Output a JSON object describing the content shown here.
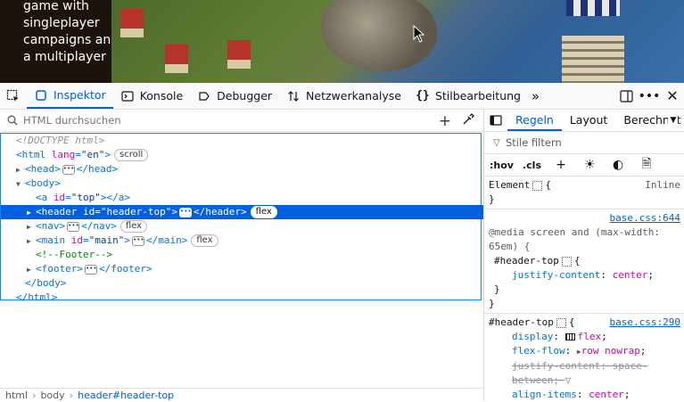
{
  "preview": {
    "intro_text": "game with singleplayer campaigns and a multiplayer"
  },
  "toolbar": {
    "tabs": [
      {
        "label": "Inspektor",
        "icon": "inspector-icon",
        "active": true
      },
      {
        "label": "Konsole",
        "icon": "console-icon"
      },
      {
        "label": "Debugger",
        "icon": "debugger-icon"
      },
      {
        "label": "Netzwerkanalyse",
        "icon": "network-icon"
      },
      {
        "label": "Stilbearbeitung",
        "icon": "style-editor-icon"
      }
    ],
    "accent": "#0060df"
  },
  "markup": {
    "search_placeholder": "HTML durchsuchen",
    "doctype": "<!DOCTYPE html>",
    "html_tag": "html",
    "html_attr": "lang",
    "html_val": "\"en\"",
    "html_badge": "scroll",
    "head_tag": "head",
    "body_tag": "body",
    "a_tag": "a",
    "a_attr": "id",
    "a_val": "\"top\"",
    "header_tag": "header",
    "header_attr": "id",
    "header_val": "\"header-top\"",
    "header_badge": "flex",
    "nav_tag": "nav",
    "nav_badge": "flex",
    "main_tag": "main",
    "main_attr": "id",
    "main_val": "\"main\"",
    "main_badge": "flex",
    "comment": "<!--Footer-->",
    "footer_tag": "footer"
  },
  "breadcrumbs": [
    "html",
    "body",
    "header#header-top"
  ],
  "rules_panel": {
    "tabs": [
      "Regeln",
      "Layout",
      "Berechnet"
    ],
    "filter_placeholder": "Stile filtern",
    "pseudo": ":hov",
    "classes": ".cls",
    "element_selector": "Element",
    "element_brace": "{",
    "element_close": "}",
    "inline": "Inline",
    "media_source": "base.css:644",
    "media_query": "@media screen and (max-width: 65em) {",
    "media_selector": "#header-top",
    "media_prop": "justify-content",
    "media_value": "center",
    "rule_source": "base.css:290",
    "rule_selector": "#header-top",
    "props": [
      {
        "name": "display",
        "value": "flex"
      },
      {
        "name": "flex-flow",
        "value": "row nowrap"
      },
      {
        "name": "justify-content",
        "value": "space-between",
        "overridden": true
      },
      {
        "name": "align-items",
        "value": "center"
      }
    ]
  }
}
